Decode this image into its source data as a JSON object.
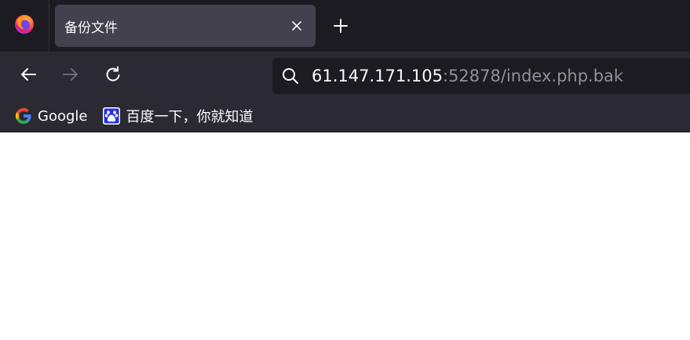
{
  "tab": {
    "title": "备份文件",
    "close_icon": "close-icon"
  },
  "new_tab_icon": "plus-icon",
  "navbar": {
    "back_icon": "arrow-left-icon",
    "forward_icon": "arrow-right-icon",
    "reload_icon": "reload-icon"
  },
  "urlbar": {
    "host": "61.147.171.105",
    "rest": ":52878/index.php.bak"
  },
  "bookmarks": [
    {
      "label": "Google",
      "icon": "google-icon"
    },
    {
      "label": "百度一下，你就知道",
      "icon": "baidu-paw-icon"
    }
  ],
  "colors": {
    "tabstrip": "#1c1b22",
    "toolbar": "#2b2a33",
    "active_tab": "#42414d",
    "text": "#fbfbfe",
    "url_dim": "#8f8f9d"
  }
}
